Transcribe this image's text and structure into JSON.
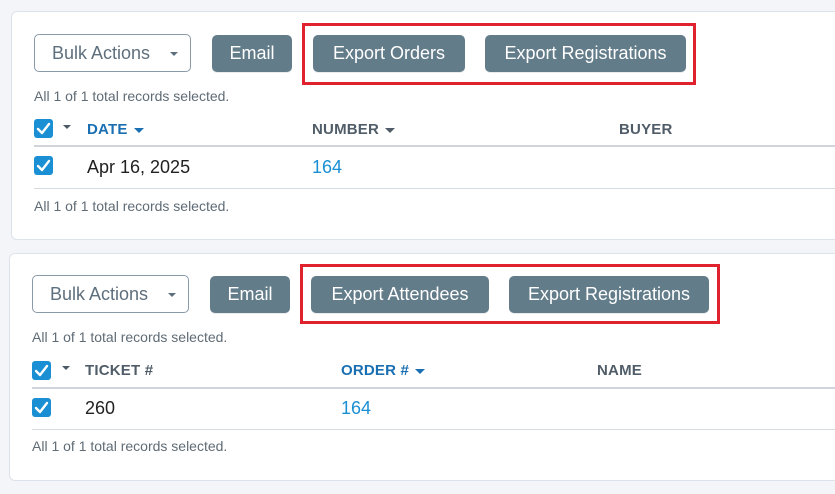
{
  "panels": [
    {
      "bulk_actions_label": "Bulk Actions",
      "buttons": [
        "Email",
        "Export Orders",
        "Export Registrations"
      ],
      "selection_summary_top": "All 1 of 1 total records selected.",
      "selection_summary_bottom": "All 1 of 1 total records selected.",
      "columns": [
        "DATE",
        "NUMBER",
        "BUYER"
      ],
      "sorted_column": "DATE",
      "rows": [
        {
          "checked": true,
          "cells": [
            "Apr 16, 2025",
            "164",
            ""
          ]
        }
      ]
    },
    {
      "bulk_actions_label": "Bulk Actions",
      "buttons": [
        "Email",
        "Export Attendees",
        "Export Registrations"
      ],
      "selection_summary_top": "All 1 of 1 total records selected.",
      "selection_summary_bottom": "All 1 of 1 total records selected.",
      "columns": [
        "TICKET #",
        "ORDER #",
        "NAME"
      ],
      "sorted_column": "ORDER #",
      "rows": [
        {
          "checked": true,
          "cells": [
            "260",
            "164",
            ""
          ]
        }
      ]
    }
  ],
  "colors": {
    "button_bg": "#637c8a",
    "highlight_border": "#e0222f",
    "checkbox": "#1a8fd4",
    "link": "#1a8fd4",
    "active_header": "#1a6fb2"
  }
}
